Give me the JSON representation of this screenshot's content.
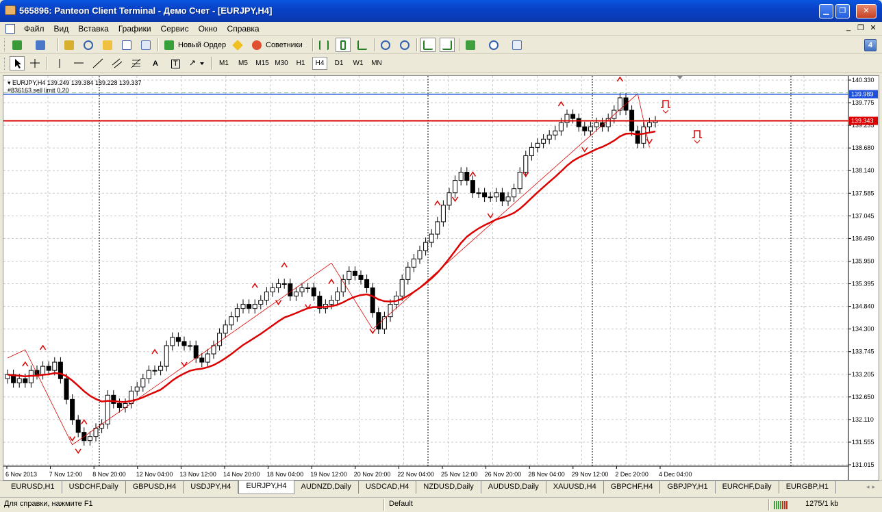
{
  "window": {
    "title": "565896: Panteon Client Terminal - Демо Счет - [EURJPY,H4]",
    "minimize": "▁",
    "maximize": "❐",
    "close": "✕"
  },
  "menu": {
    "items": [
      "Файл",
      "Вид",
      "Вставка",
      "Графики",
      "Сервис",
      "Окно",
      "Справка"
    ],
    "mdi": [
      "_",
      "❐",
      "✕"
    ]
  },
  "toolbar": {
    "new_order": "Новый Ордер",
    "advisors": "Советники",
    "alerts_glyph": "4",
    "tools": {
      "text_tool": "A",
      "label_tool": "T"
    },
    "timeframes": [
      "M1",
      "M5",
      "M15",
      "M30",
      "H1",
      "H4",
      "D1",
      "W1",
      "MN"
    ],
    "active_timeframe": "H4"
  },
  "chart": {
    "header_line1": "EURJPY,H4  139.249 139.384 139.228 139.337",
    "header_line2": "#836163 sell limit 0.20",
    "price_labels": [
      "140.330",
      "139.775",
      "139.235",
      "138.680",
      "138.140",
      "137.585",
      "137.045",
      "136.490",
      "135.950",
      "135.395",
      "134.840",
      "134.300",
      "133.745",
      "133.205",
      "132.650",
      "132.110",
      "131.555",
      "131.015"
    ],
    "order_line_price": "139.989",
    "bid_price": "139.343",
    "date_labels": [
      "6 Nov 2013",
      "7 Nov 12:00",
      "8 Nov 20:00",
      "12 Nov 04:00",
      "13 Nov 12:00",
      "14 Nov 20:00",
      "18 Nov 04:00",
      "19 Nov 12:00",
      "20 Nov 20:00",
      "22 Nov 04:00",
      "25 Nov 12:00",
      "26 Nov 20:00",
      "28 Nov 04:00",
      "29 Nov 12:00",
      "2 Dec 20:00",
      "4 Dec 04:00"
    ],
    "colors": {
      "candle_up": "#ffffff",
      "candle_down": "#000000",
      "ma": "#dd0000",
      "zigzag": "#dd0000",
      "order_line": "#1e50dc",
      "bid_line": "#dd0000"
    }
  },
  "chart_data": {
    "type": "candlestick",
    "symbol": "EURJPY",
    "timeframe": "H4",
    "ylim": [
      131.015,
      140.33
    ],
    "ohlc_last": [
      139.249,
      139.384,
      139.228,
      139.337
    ],
    "close": [
      133.2,
      133.0,
      133.1,
      133.0,
      133.3,
      133.2,
      133.4,
      133.3,
      133.5,
      133.1,
      132.6,
      132.1,
      131.8,
      131.6,
      131.7,
      131.9,
      132.0,
      132.7,
      132.5,
      132.4,
      132.5,
      132.8,
      132.9,
      133.1,
      133.3,
      133.3,
      133.4,
      133.9,
      134.1,
      134.0,
      133.9,
      133.9,
      133.6,
      133.5,
      133.7,
      133.9,
      134.2,
      134.4,
      134.6,
      134.8,
      134.9,
      134.8,
      134.9,
      135.0,
      135.2,
      135.3,
      135.4,
      135.4,
      135.1,
      135.2,
      135.3,
      135.3,
      135.1,
      134.8,
      134.9,
      135.0,
      135.2,
      135.5,
      135.7,
      135.6,
      135.5,
      135.3,
      134.7,
      134.3,
      134.6,
      134.9,
      135.1,
      135.5,
      135.8,
      136.0,
      136.2,
      136.4,
      136.6,
      136.9,
      137.3,
      137.6,
      137.9,
      138.1,
      137.9,
      137.6,
      137.6,
      137.5,
      137.5,
      137.6,
      137.4,
      137.5,
      137.7,
      138.1,
      138.5,
      138.7,
      138.8,
      138.9,
      139.0,
      139.1,
      139.3,
      139.5,
      139.4,
      139.2,
      139.1,
      139.2,
      139.3,
      139.2,
      139.4,
      139.6,
      139.9,
      139.6,
      139.1,
      138.8,
      139.2,
      139.3,
      139.34
    ],
    "ma_series": "smoothed moving average",
    "order_line": 139.989,
    "bid": 139.343
  }
}
